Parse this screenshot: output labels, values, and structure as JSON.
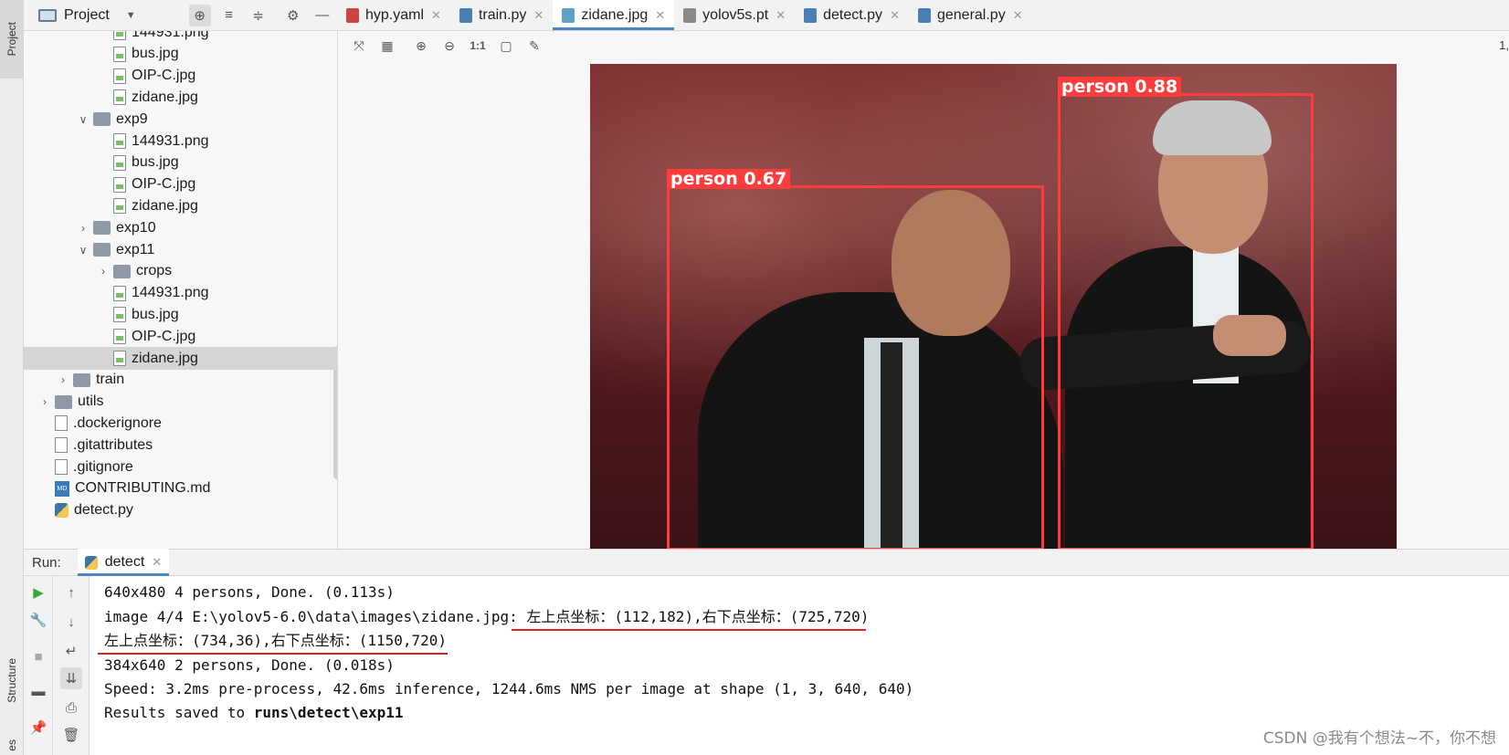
{
  "left_strip": {
    "project_label": "Project",
    "structure_label": "Structure",
    "bottom_label": "es"
  },
  "project_header": {
    "title": "Project"
  },
  "tabs": [
    {
      "label": "hyp.yaml",
      "icon": "yaml-file-icon"
    },
    {
      "label": "train.py",
      "icon": "python-file-icon"
    },
    {
      "label": "zidane.jpg",
      "icon": "image-file-icon",
      "active": true
    },
    {
      "label": "yolov5s.pt",
      "icon": "binary-file-icon"
    },
    {
      "label": "detect.py",
      "icon": "python-file-icon"
    },
    {
      "label": "general.py",
      "icon": "python-file-icon"
    }
  ],
  "tree": [
    {
      "label": "144931.png",
      "type": "image"
    },
    {
      "label": "bus.jpg",
      "type": "image"
    },
    {
      "label": "OIP-C.jpg",
      "type": "image"
    },
    {
      "label": "zidane.jpg",
      "type": "image"
    },
    {
      "label": "exp9",
      "type": "folder",
      "expanded": true
    },
    {
      "label": "144931.png",
      "type": "image"
    },
    {
      "label": "bus.jpg",
      "type": "image"
    },
    {
      "label": "OIP-C.jpg",
      "type": "image"
    },
    {
      "label": "zidane.jpg",
      "type": "image"
    },
    {
      "label": "exp10",
      "type": "folder",
      "expanded": false
    },
    {
      "label": "exp11",
      "type": "folder",
      "expanded": true
    },
    {
      "label": "crops",
      "type": "folder",
      "expanded": false
    },
    {
      "label": "144931.png",
      "type": "image"
    },
    {
      "label": "bus.jpg",
      "type": "image"
    },
    {
      "label": "OIP-C.jpg",
      "type": "image"
    },
    {
      "label": "zidane.jpg",
      "type": "image",
      "selected": true
    },
    {
      "label": "train",
      "type": "folder",
      "expanded": false
    },
    {
      "label": "utils",
      "type": "folder",
      "expanded": false
    },
    {
      "label": ".dockerignore",
      "type": "text"
    },
    {
      "label": ".gitattributes",
      "type": "text"
    },
    {
      "label": ".gitignore",
      "type": "text"
    },
    {
      "label": "CONTRIBUTING.md",
      "type": "markdown"
    },
    {
      "label": "detect.py",
      "type": "python"
    }
  ],
  "viewer": {
    "zoom_readout": "1,",
    "ratio_button": "1:1",
    "detections": [
      {
        "label": "person 0.67"
      },
      {
        "label": "person 0.88"
      }
    ]
  },
  "run": {
    "title": "Run:",
    "tab_label": "detect",
    "console": {
      "line1": "640x480 4 persons, Done. (0.113s)",
      "line2a": "image 4/4 E:\\yolov5-6.0\\data\\images\\zidane.jpg: ",
      "line2b": "左上点坐标：(112,182),右下点坐标：(725,720)",
      "line3": "左上点坐标：(734,36),右下点坐标：(1150,720)",
      "line4": "384x640 2 persons, Done. (0.018s)",
      "line5": "Speed: 3.2ms pre-process, 42.6ms inference, 1244.6ms NMS per image at shape (1, 3, 640, 640)",
      "line6a": "Results saved to ",
      "line6b": "runs\\detect\\exp11"
    }
  },
  "watermark": "CSDN @我有个想法~不，你不想",
  "colors": {
    "bbox": "#ff3b3b",
    "accent": "#4a86c8",
    "underline": "#e02020"
  }
}
